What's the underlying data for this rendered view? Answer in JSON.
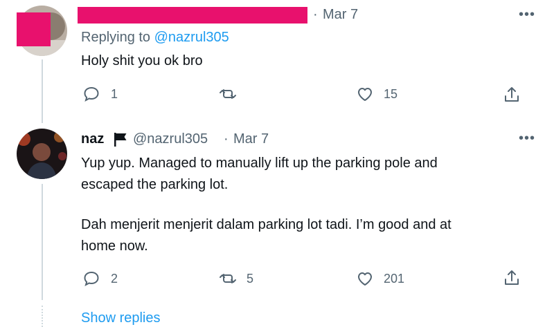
{
  "tweet1": {
    "timestamp": "Mar 7",
    "replying_label": "Replying to",
    "replying_handle": "@nazrul305",
    "text": "Holy shit you ok bro",
    "actions": {
      "reply_count": "1",
      "retweet_count": "",
      "like_count": "15"
    },
    "redaction_color": "#e8116d"
  },
  "tweet2": {
    "name": "naz",
    "handle": "@nazrul305",
    "separator": "·",
    "timestamp": "Mar 7",
    "text_p1": "Yup yup. Managed to manually lift up the parking pole and\nescaped the parking lot.",
    "text_p2": "Dah menjerit menjerit dalam parking lot tadi. I’m good and at\nhome now.",
    "actions": {
      "reply_count": "2",
      "retweet_count": "5",
      "like_count": "201"
    }
  },
  "show_replies": "Show replies",
  "icons": {
    "more": "more-icon",
    "reply": "reply-icon",
    "retweet": "retweet-icon",
    "like": "like-icon",
    "share": "share-icon",
    "flag": "flag-icon"
  },
  "colors": {
    "link": "#1d9bf0",
    "secondary_text": "#536471",
    "thread_line": "#cfd9de"
  }
}
